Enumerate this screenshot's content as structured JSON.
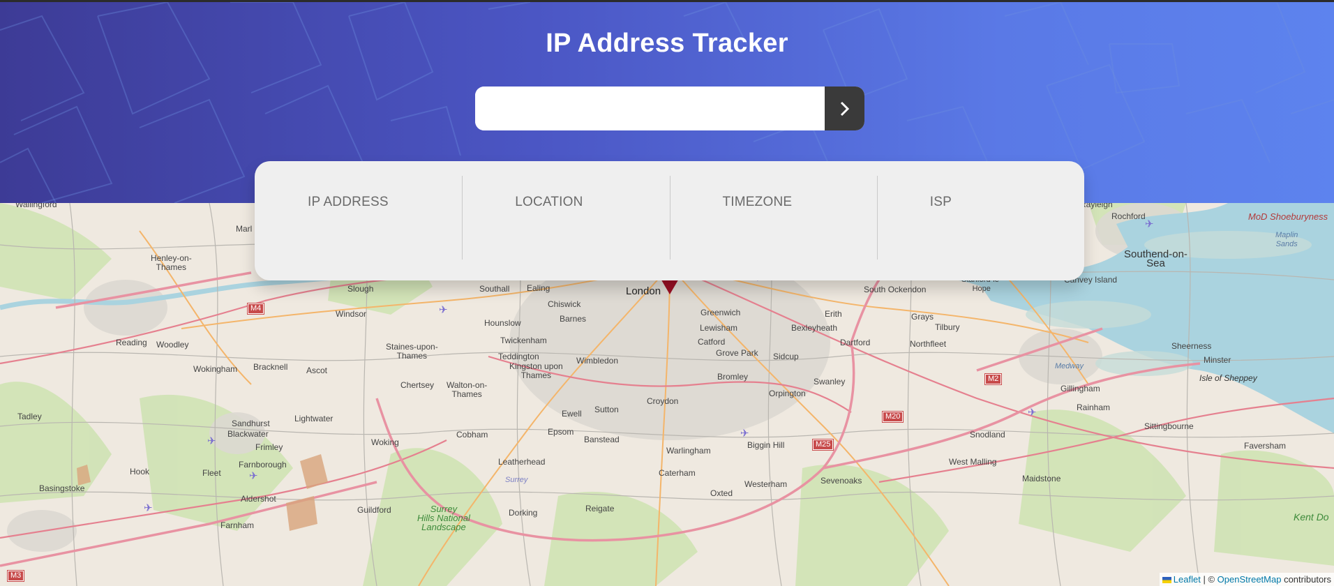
{
  "header": {
    "title": "IP Address Tracker",
    "search": {
      "value": "",
      "placeholder": ""
    },
    "submit_icon": "chevron-right-icon"
  },
  "info": {
    "fields": [
      {
        "label": "IP ADDRESS",
        "value": ""
      },
      {
        "label": "LOCATION",
        "value": ""
      },
      {
        "label": "TIMEZONE",
        "value": ""
      },
      {
        "label": "ISP",
        "value": ""
      }
    ]
  },
  "map": {
    "marker_icon": "location-marker-icon",
    "places": {
      "wallingford": "Wallingford",
      "marlow": "Marl",
      "henley": "Henley-on-\nThames",
      "reading": "Reading",
      "woodley": "Woodley",
      "slough": "Slough",
      "southall": "Southall",
      "ealing": "Ealing",
      "chiswick": "Chiswick",
      "london": "London",
      "greenwich": "Greenwich",
      "windsor": "Windsor",
      "hounslow": "Hounslow",
      "barnes": "Barnes",
      "lewisham": "Lewisham",
      "erith": "Erith",
      "grays": "Grays",
      "tilbury": "Tilbury",
      "south_ockendon": "South Ockendon",
      "stanford": "Stanford-le-\nHope",
      "bexleyheath": "Bexleyheath",
      "dartford": "Dartford",
      "northfleet": "Northfleet",
      "bracknell": "Bracknell",
      "ascot": "Ascot",
      "wokingham": "Wokingham",
      "staines": "Staines-upon-\nThames",
      "twickenham": "Twickenham",
      "teddington": "Teddington",
      "kingston": "Kingston upon\nThames",
      "wimbledon": "Wimbledon",
      "catford": "Catford",
      "grove_park": "Grove Park",
      "sidcup": "Sidcup",
      "bromley": "Bromley",
      "swanley": "Swanley",
      "orpington": "Orpington",
      "chertsey": "Chertsey",
      "walton": "Walton-on-\nThames",
      "croydon": "Croydon",
      "sutton": "Sutton",
      "ewell": "Ewell",
      "epsom": "Epsom",
      "banstead": "Banstead",
      "cobham": "Cobham",
      "tadley": "Tadley",
      "sandhurst": "Sandhurst",
      "blackwater": "Blackwater",
      "lightwater": "Lightwater",
      "frimley": "Frimley",
      "woking": "Woking",
      "leatherhead": "Leatherhead",
      "warlingham": "Warlingham",
      "biggin_hill": "Biggin Hill",
      "caterham": "Caterham",
      "oxted": "Oxted",
      "westerham": "Westerham",
      "sevenoaks": "Sevenoaks",
      "farnborough": "Farnborough",
      "fleet": "Fleet",
      "hook": "Hook",
      "basingstoke": "Basingstoke",
      "aldershot": "Aldershot",
      "guildford": "Guildford",
      "dorking": "Dorking",
      "reigate": "Reigate",
      "farnham": "Farnham",
      "surrey": "Surrey",
      "surrey_hills": "Surrey\nHills National\nLandscape",
      "snodland": "Snodland",
      "west_malling": "West Malling",
      "maidstone": "Maidstone",
      "gillingham": "Gillingham",
      "rainham": "Rainham",
      "sittingbourne": "Sittingbourne",
      "faversham": "Faversham",
      "sheerness": "Sheerness",
      "minster": "Minster",
      "isle_of_sheppey": "Isle of Sheppey",
      "medway": "Medway",
      "rayleigh": "Rayleigh",
      "rochford": "Rochford",
      "southend": "Southend-on-\nSea",
      "canvey": "Canvey Island",
      "mod_shoeburyness": "MoD Shoeburyness",
      "maplin": "Maplin\nSands",
      "kent_downs": "Kent Do"
    },
    "roads": {
      "m4": "M4",
      "m3": "M3",
      "m25": "M25",
      "m20": "M20",
      "m2": "M2"
    },
    "attribution": {
      "leaflet": "Leaflet",
      "separator": "| ©",
      "osm": "OpenStreetMap",
      "suffix": "contributors"
    }
  }
}
